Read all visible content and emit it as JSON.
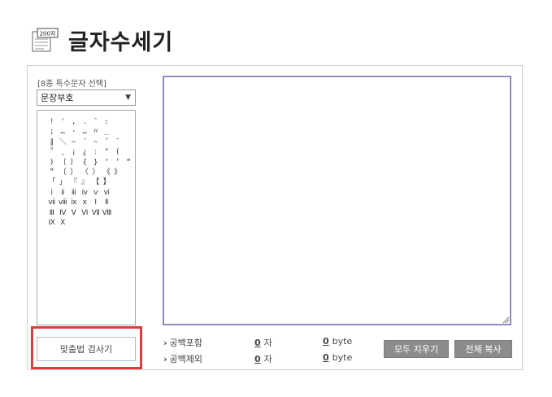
{
  "header": {
    "icon_badge": "200자",
    "title": "글자수세기"
  },
  "special_chars": {
    "label": "[8종 특수문자 선택]",
    "selected_category": "문장부호",
    "rows": [
      [
        "!",
        "'",
        ",",
        ".",
        "¯",
        ":"
      ],
      [
        ";",
        "…",
        "·",
        "…",
        "〃",
        "_"
      ],
      [
        "∥",
        "＼",
        "∼",
        "´",
        "~",
        "ˇ",
        "˘"
      ],
      [
        "˚",
        "¸",
        "¡",
        "¿",
        "ː",
        "\"",
        "("
      ],
      [
        ")",
        "〔",
        "〕",
        "{",
        "}",
        "‘",
        "’",
        "“"
      ],
      [
        "”",
        "〔",
        "〕",
        "〈",
        "〉",
        "《",
        "》"
      ],
      [
        "「",
        "」",
        "『",
        "』",
        "【",
        "】"
      ],
      [
        "ⅰ",
        "ⅱ",
        "ⅲ",
        "ⅳ",
        "ⅴ",
        "ⅵ"
      ],
      [
        "ⅶ",
        "ⅷ",
        "ⅸ",
        "ⅹ",
        "Ⅰ",
        "Ⅱ"
      ],
      [
        "Ⅲ",
        "Ⅳ",
        "Ⅴ",
        "Ⅵ",
        "Ⅶ",
        "Ⅷ"
      ],
      [
        "Ⅸ",
        "Ⅹ"
      ]
    ]
  },
  "spell_check_button": "맞춤법 검사기",
  "editor": {
    "value": ""
  },
  "stats": {
    "with_spaces_label": "공백포함",
    "without_spaces_label": "공백제외",
    "with_spaces_chars": "0",
    "with_spaces_bytes": "0",
    "without_spaces_chars": "0",
    "without_spaces_bytes": "0",
    "char_unit": "자",
    "byte_unit": "byte",
    "caret": "›"
  },
  "buttons": {
    "clear_all": "모두 지우기",
    "copy_all": "전체 복사"
  }
}
